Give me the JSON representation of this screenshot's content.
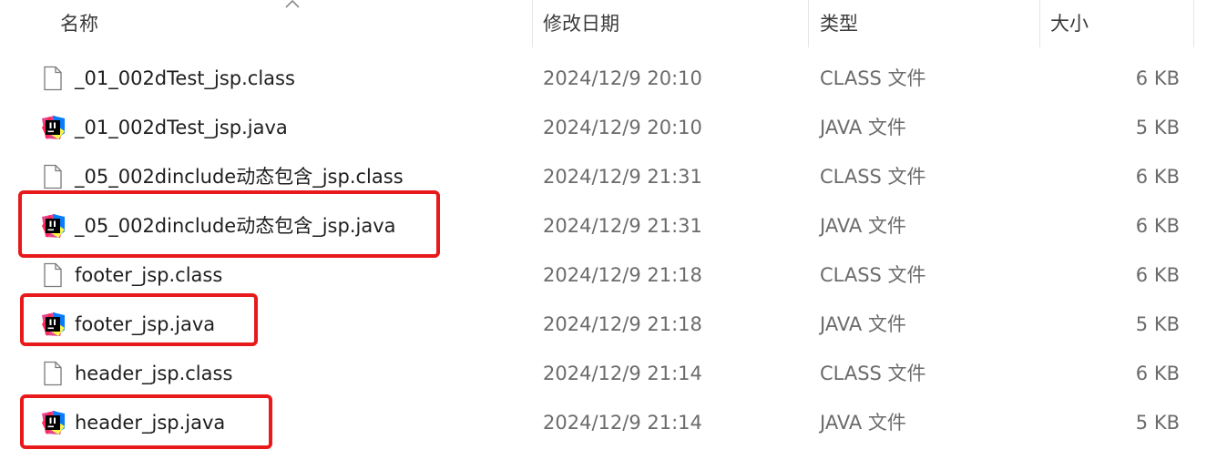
{
  "columns": {
    "name": "名称",
    "modified": "修改日期",
    "type": "类型",
    "size": "大小"
  },
  "files": [
    {
      "name": "_01_002dTest_jsp.class",
      "modified": "2024/12/9 20:10",
      "type": "CLASS 文件",
      "size": "6 KB",
      "icon": "file-icon"
    },
    {
      "name": "_01_002dTest_jsp.java",
      "modified": "2024/12/9 20:10",
      "type": "JAVA 文件",
      "size": "5 KB",
      "icon": "intellij-java-icon"
    },
    {
      "name": "_05_002dinclude动态包含_jsp.class",
      "modified": "2024/12/9 21:31",
      "type": "CLASS 文件",
      "size": "6 KB",
      "icon": "file-icon"
    },
    {
      "name": "_05_002dinclude动态包含_jsp.java",
      "modified": "2024/12/9 21:31",
      "type": "JAVA 文件",
      "size": "6 KB",
      "icon": "intellij-java-icon"
    },
    {
      "name": "footer_jsp.class",
      "modified": "2024/12/9 21:18",
      "type": "CLASS 文件",
      "size": "6 KB",
      "icon": "file-icon"
    },
    {
      "name": "footer_jsp.java",
      "modified": "2024/12/9 21:18",
      "type": "JAVA 文件",
      "size": "5 KB",
      "icon": "intellij-java-icon"
    },
    {
      "name": "header_jsp.class",
      "modified": "2024/12/9 21:14",
      "type": "CLASS 文件",
      "size": "6 KB",
      "icon": "file-icon"
    },
    {
      "name": "header_jsp.java",
      "modified": "2024/12/9 21:14",
      "type": "JAVA 文件",
      "size": "5 KB",
      "icon": "intellij-java-icon"
    }
  ],
  "highlight_color": "#e8191b"
}
